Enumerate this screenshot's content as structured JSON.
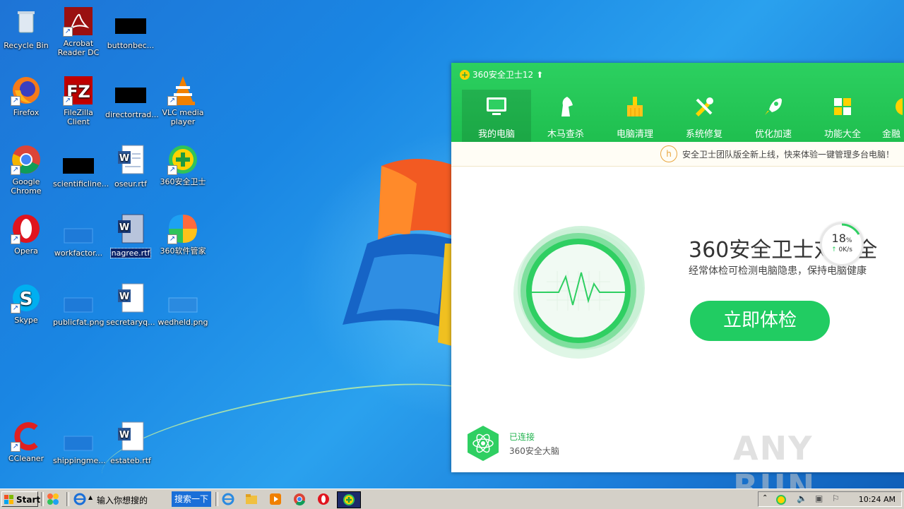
{
  "desktop": {
    "icons": [
      {
        "label": "Recycle Bin",
        "icon": "recycle-bin-icon"
      },
      {
        "label": "Acrobat Reader DC",
        "icon": "acrobat-icon"
      },
      {
        "label": "buttonbec...",
        "icon": "file-icon"
      },
      {
        "label": "Firefox",
        "icon": "firefox-icon"
      },
      {
        "label": "FileZilla Client",
        "icon": "filezilla-icon"
      },
      {
        "label": "directortrad...",
        "icon": "file-icon"
      },
      {
        "label": "VLC media player",
        "icon": "vlc-icon"
      },
      {
        "label": "Google Chrome",
        "icon": "chrome-icon"
      },
      {
        "label": "scientificline...",
        "icon": "file-icon"
      },
      {
        "label": "oseur.rtf",
        "icon": "word-doc-icon"
      },
      {
        "label": "360安全卫士",
        "icon": "360-safe-icon"
      },
      {
        "label": "Opera",
        "icon": "opera-icon"
      },
      {
        "label": "workfactor...",
        "icon": "file-icon"
      },
      {
        "label": "nagree.rtf",
        "icon": "word-doc-icon"
      },
      {
        "label": "360软件管家",
        "icon": "360-software-icon"
      },
      {
        "label": "Skype",
        "icon": "skype-icon"
      },
      {
        "label": "publicfat.png",
        "icon": "image-file-icon"
      },
      {
        "label": "secretaryq...",
        "icon": "word-doc-icon"
      },
      {
        "label": "wedheld.png",
        "icon": "image-file-icon"
      },
      {
        "label": "CCleaner",
        "icon": "ccleaner-icon"
      },
      {
        "label": "shippingme...",
        "icon": "file-icon"
      },
      {
        "label": "estateb.rtf",
        "icon": "word-doc-icon"
      }
    ]
  },
  "app": {
    "title": "360安全卫士12",
    "nav": [
      {
        "label": "我的电脑",
        "icon": "monitor-icon"
      },
      {
        "label": "木马查杀",
        "icon": "horse-icon"
      },
      {
        "label": "电脑清理",
        "icon": "broom-icon"
      },
      {
        "label": "系统修复",
        "icon": "wrench-icon"
      },
      {
        "label": "优化加速",
        "icon": "rocket-icon"
      },
      {
        "label": "功能大全",
        "icon": "grid-icon"
      },
      {
        "label": "金融",
        "icon": "finance-icon"
      }
    ],
    "notice": "安全卫士团队版全新上线，快来体验一键管理多台电脑！",
    "headline": "360安全卫士对",
    "headline_tail": "您全",
    "subline": "经常体检可检测电脑隐患，保持电脑健康",
    "check_button": "立即体检",
    "speed_pct": "18",
    "speed_pct_unit": "%",
    "speed_rate": "0K/s",
    "brain_status": "已连接",
    "brain_name": "360安全大脑",
    "accent": "#21cc62"
  },
  "watermark": "ANY RUN",
  "taskbar": {
    "start_label": "Start",
    "search_text": "输入你想搜的",
    "search_button": "搜索一下",
    "clock": "10:24 AM"
  }
}
